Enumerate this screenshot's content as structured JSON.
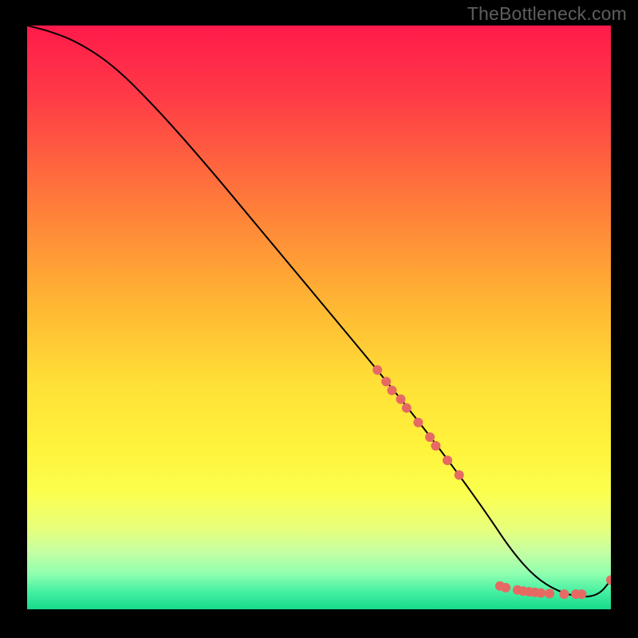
{
  "watermark": "TheBottleneck.com",
  "chart_data": {
    "type": "line",
    "title": "",
    "xlabel": "",
    "ylabel": "",
    "xlim": [
      0,
      100
    ],
    "ylim": [
      0,
      100
    ],
    "background_gradient": {
      "stops": [
        {
          "offset": 0,
          "color": "#ff1a4b"
        },
        {
          "offset": 12,
          "color": "#ff3a47"
        },
        {
          "offset": 30,
          "color": "#ff7a3a"
        },
        {
          "offset": 48,
          "color": "#ffb733"
        },
        {
          "offset": 62,
          "color": "#ffe237"
        },
        {
          "offset": 72,
          "color": "#fff23b"
        },
        {
          "offset": 80,
          "color": "#fbff4e"
        },
        {
          "offset": 86,
          "color": "#e9ff7a"
        },
        {
          "offset": 90,
          "color": "#c8ffa2"
        },
        {
          "offset": 94,
          "color": "#8effb0"
        },
        {
          "offset": 97,
          "color": "#45f0a2"
        },
        {
          "offset": 100,
          "color": "#17d98b"
        }
      ]
    },
    "series": [
      {
        "name": "bottleneck-curve",
        "color": "#000000",
        "x": [
          0,
          4,
          9,
          15,
          22,
          30,
          40,
          50,
          60,
          68,
          74,
          79,
          83,
          87,
          91,
          95,
          98,
          100
        ],
        "y": [
          100,
          99,
          97,
          93,
          86,
          77,
          65,
          53,
          41,
          31,
          23,
          16,
          10,
          5.5,
          3,
          2,
          2.5,
          5
        ]
      }
    ],
    "markers": {
      "name": "highlight-points",
      "color": "#e66a63",
      "radius": 6,
      "points": [
        {
          "x": 60.0,
          "y": 41.0
        },
        {
          "x": 61.5,
          "y": 39.0
        },
        {
          "x": 62.5,
          "y": 37.5
        },
        {
          "x": 64.0,
          "y": 36.0
        },
        {
          "x": 65.0,
          "y": 34.5
        },
        {
          "x": 67.0,
          "y": 32.0
        },
        {
          "x": 69.0,
          "y": 29.5
        },
        {
          "x": 70.0,
          "y": 28.0
        },
        {
          "x": 72.0,
          "y": 25.5
        },
        {
          "x": 74.0,
          "y": 23.0
        },
        {
          "x": 81.0,
          "y": 4.0
        },
        {
          "x": 82.0,
          "y": 3.7
        },
        {
          "x": 84.0,
          "y": 3.3
        },
        {
          "x": 85.0,
          "y": 3.1
        },
        {
          "x": 86.0,
          "y": 3.0
        },
        {
          "x": 87.0,
          "y": 2.9
        },
        {
          "x": 88.0,
          "y": 2.8
        },
        {
          "x": 89.5,
          "y": 2.7
        },
        {
          "x": 92.0,
          "y": 2.6
        },
        {
          "x": 94.0,
          "y": 2.6
        },
        {
          "x": 95.0,
          "y": 2.6
        },
        {
          "x": 100.0,
          "y": 5.0
        }
      ]
    }
  }
}
